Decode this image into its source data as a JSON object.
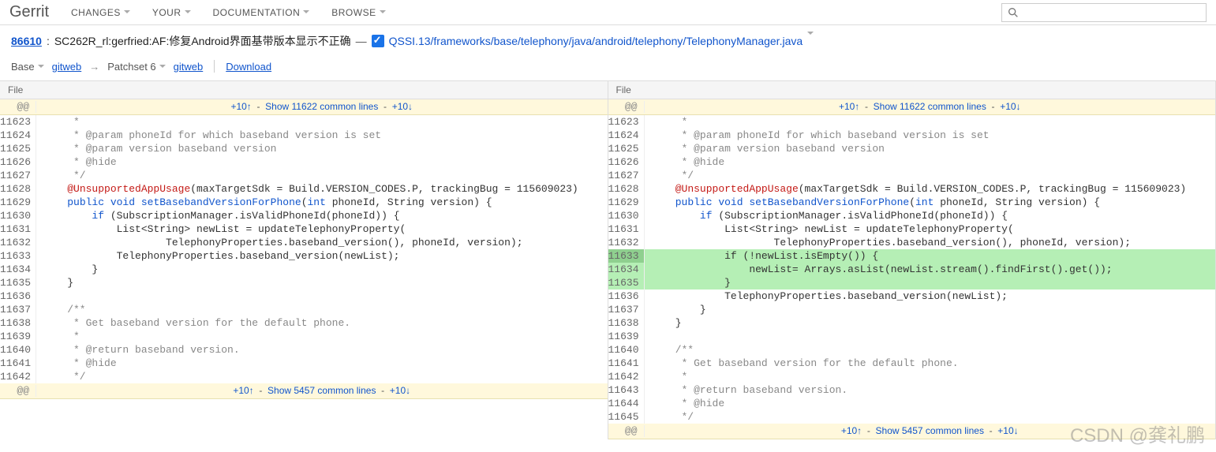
{
  "topnav": {
    "logo": "Gerrit",
    "items": [
      "CHANGES",
      "YOUR",
      "DOCUMENTATION",
      "BROWSE"
    ]
  },
  "breadcrumb": {
    "change_id": "86610",
    "sep1": ": ",
    "title": "SC262R_rl:gerfried:AF:修复Android界面基带版本显示不正确",
    "dash": " — ",
    "file_path": "QSSI.13/frameworks/base/telephony/java/android/telephony/TelephonyManager.java"
  },
  "patchbar": {
    "base": "Base",
    "gitweb1": "gitweb",
    "arrow": "→",
    "patchset": "Patchset 6",
    "gitweb2": "gitweb",
    "download": "Download"
  },
  "file_label": "File",
  "hunk_at": "@@",
  "hunk1": {
    "up": "+10↑",
    "mid": "Show 11622 common lines",
    "down": "+10↓"
  },
  "hunk2": {
    "up": "+10↑",
    "mid": "Show 5457 common lines",
    "down": "+10↓"
  },
  "left": [
    {
      "n": "11623",
      "cls": "",
      "seg": [
        {
          "c": "cmt",
          "t": "     *"
        }
      ]
    },
    {
      "n": "11624",
      "cls": "",
      "seg": [
        {
          "c": "cmt",
          "t": "     * @param phoneId for which baseband version is set"
        }
      ]
    },
    {
      "n": "11625",
      "cls": "",
      "seg": [
        {
          "c": "cmt",
          "t": "     * @param version baseband version"
        }
      ]
    },
    {
      "n": "11626",
      "cls": "",
      "seg": [
        {
          "c": "cmt",
          "t": "     * @hide"
        }
      ]
    },
    {
      "n": "11627",
      "cls": "",
      "seg": [
        {
          "c": "cmt",
          "t": "     */"
        }
      ]
    },
    {
      "n": "11628",
      "cls": "",
      "seg": [
        {
          "c": "",
          "t": "    "
        },
        {
          "c": "ann",
          "t": "@UnsupportedAppUsage"
        },
        {
          "c": "",
          "t": "(maxTargetSdk = Build.VERSION_CODES.P, trackingBug = 115609023)"
        }
      ]
    },
    {
      "n": "11629",
      "cls": "",
      "seg": [
        {
          "c": "",
          "t": "    "
        },
        {
          "c": "kw",
          "t": "public void "
        },
        {
          "c": "fn",
          "t": "setBasebandVersionForPhone"
        },
        {
          "c": "",
          "t": "("
        },
        {
          "c": "ty",
          "t": "int"
        },
        {
          "c": "",
          "t": " phoneId, String version) {"
        }
      ]
    },
    {
      "n": "11630",
      "cls": "",
      "seg": [
        {
          "c": "",
          "t": "        "
        },
        {
          "c": "kw",
          "t": "if"
        },
        {
          "c": "",
          "t": " (SubscriptionManager.isValidPhoneId(phoneId)) {"
        }
      ]
    },
    {
      "n": "11631",
      "cls": "",
      "seg": [
        {
          "c": "",
          "t": "            List<String> newList = updateTelephonyProperty("
        }
      ]
    },
    {
      "n": "11632",
      "cls": "",
      "seg": [
        {
          "c": "",
          "t": "                    TelephonyProperties.baseband_version(), phoneId, version);"
        }
      ]
    },
    {
      "n": "11633",
      "cls": "",
      "seg": [
        {
          "c": "",
          "t": "            TelephonyProperties.baseband_version(newList);"
        }
      ]
    },
    {
      "n": "11634",
      "cls": "",
      "seg": [
        {
          "c": "",
          "t": "        }"
        }
      ]
    },
    {
      "n": "11635",
      "cls": "",
      "seg": [
        {
          "c": "",
          "t": "    }"
        }
      ]
    },
    {
      "n": "11636",
      "cls": "",
      "seg": [
        {
          "c": "",
          "t": ""
        }
      ]
    },
    {
      "n": "11637",
      "cls": "",
      "seg": [
        {
          "c": "cmt",
          "t": "    /**"
        }
      ]
    },
    {
      "n": "11638",
      "cls": "",
      "seg": [
        {
          "c": "cmt",
          "t": "     * Get baseband version for the default phone."
        }
      ]
    },
    {
      "n": "11639",
      "cls": "",
      "seg": [
        {
          "c": "cmt",
          "t": "     *"
        }
      ]
    },
    {
      "n": "11640",
      "cls": "",
      "seg": [
        {
          "c": "cmt",
          "t": "     * @return baseband version."
        }
      ]
    },
    {
      "n": "11641",
      "cls": "",
      "seg": [
        {
          "c": "cmt",
          "t": "     * @hide"
        }
      ]
    },
    {
      "n": "11642",
      "cls": "",
      "seg": [
        {
          "c": "cmt",
          "t": "     */"
        }
      ]
    }
  ],
  "right": [
    {
      "n": "11623",
      "cls": "",
      "seg": [
        {
          "c": "cmt",
          "t": "     *"
        }
      ]
    },
    {
      "n": "11624",
      "cls": "",
      "seg": [
        {
          "c": "cmt",
          "t": "     * @param phoneId for which baseband version is set"
        }
      ]
    },
    {
      "n": "11625",
      "cls": "",
      "seg": [
        {
          "c": "cmt",
          "t": "     * @param version baseband version"
        }
      ]
    },
    {
      "n": "11626",
      "cls": "",
      "seg": [
        {
          "c": "cmt",
          "t": "     * @hide"
        }
      ]
    },
    {
      "n": "11627",
      "cls": "",
      "seg": [
        {
          "c": "cmt",
          "t": "     */"
        }
      ]
    },
    {
      "n": "11628",
      "cls": "",
      "seg": [
        {
          "c": "",
          "t": "    "
        },
        {
          "c": "ann",
          "t": "@UnsupportedAppUsage"
        },
        {
          "c": "",
          "t": "(maxTargetSdk = Build.VERSION_CODES.P, trackingBug = 115609023)"
        }
      ]
    },
    {
      "n": "11629",
      "cls": "",
      "seg": [
        {
          "c": "",
          "t": "    "
        },
        {
          "c": "kw",
          "t": "public void "
        },
        {
          "c": "fn",
          "t": "setBasebandVersionForPhone"
        },
        {
          "c": "",
          "t": "("
        },
        {
          "c": "ty",
          "t": "int"
        },
        {
          "c": "",
          "t": " phoneId, String version) {"
        }
      ]
    },
    {
      "n": "11630",
      "cls": "",
      "seg": [
        {
          "c": "",
          "t": "        "
        },
        {
          "c": "kw",
          "t": "if"
        },
        {
          "c": "",
          "t": " (SubscriptionManager.isValidPhoneId(phoneId)) {"
        }
      ]
    },
    {
      "n": "11631",
      "cls": "",
      "seg": [
        {
          "c": "",
          "t": "            List<String> newList = updateTelephonyProperty("
        }
      ]
    },
    {
      "n": "11632",
      "cls": "",
      "seg": [
        {
          "c": "",
          "t": "                    TelephonyProperties.baseband_version(), phoneId, version);"
        }
      ]
    },
    {
      "n": "11633",
      "cls": "add-focus",
      "seg": [
        {
          "c": "",
          "t": "            if (!newList.isEmpty()) {"
        }
      ]
    },
    {
      "n": "11634",
      "cls": "add",
      "seg": [
        {
          "c": "",
          "t": "                newList= Arrays.asList(newList.stream().findFirst().get());"
        }
      ]
    },
    {
      "n": "11635",
      "cls": "add",
      "seg": [
        {
          "c": "",
          "t": "            }"
        }
      ]
    },
    {
      "n": "11636",
      "cls": "",
      "seg": [
        {
          "c": "",
          "t": "            TelephonyProperties.baseband_version(newList);"
        }
      ]
    },
    {
      "n": "11637",
      "cls": "",
      "seg": [
        {
          "c": "",
          "t": "        }"
        }
      ]
    },
    {
      "n": "11638",
      "cls": "",
      "seg": [
        {
          "c": "",
          "t": "    }"
        }
      ]
    },
    {
      "n": "11639",
      "cls": "",
      "seg": [
        {
          "c": "",
          "t": ""
        }
      ]
    },
    {
      "n": "11640",
      "cls": "",
      "seg": [
        {
          "c": "cmt",
          "t": "    /**"
        }
      ]
    },
    {
      "n": "11641",
      "cls": "",
      "seg": [
        {
          "c": "cmt",
          "t": "     * Get baseband version for the default phone."
        }
      ]
    },
    {
      "n": "11642",
      "cls": "",
      "seg": [
        {
          "c": "cmt",
          "t": "     *"
        }
      ]
    },
    {
      "n": "11643",
      "cls": "",
      "seg": [
        {
          "c": "cmt",
          "t": "     * @return baseband version."
        }
      ]
    },
    {
      "n": "11644",
      "cls": "",
      "seg": [
        {
          "c": "cmt",
          "t": "     * @hide"
        }
      ]
    },
    {
      "n": "11645",
      "cls": "",
      "seg": [
        {
          "c": "cmt",
          "t": "     */"
        }
      ]
    }
  ],
  "left_blank_after": 11632,
  "watermark": "CSDN @龚礼鹏"
}
